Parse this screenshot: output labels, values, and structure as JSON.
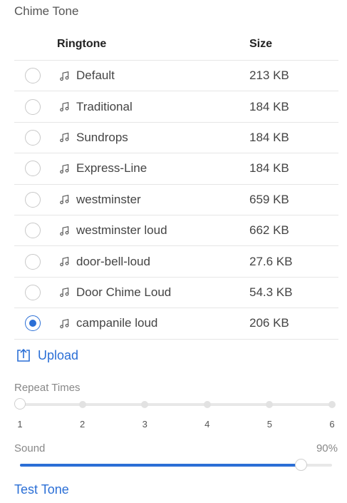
{
  "section_title": "Chime Tone",
  "table": {
    "headers": {
      "ringtone": "Ringtone",
      "size": "Size"
    },
    "rows": [
      {
        "name": "Default",
        "size": "213 KB",
        "selected": false
      },
      {
        "name": "Traditional",
        "size": "184 KB",
        "selected": false
      },
      {
        "name": "Sundrops",
        "size": "184 KB",
        "selected": false
      },
      {
        "name": "Express-Line",
        "size": "184 KB",
        "selected": false
      },
      {
        "name": "westminster",
        "size": "659 KB",
        "selected": false
      },
      {
        "name": "westminster loud",
        "size": "662 KB",
        "selected": false
      },
      {
        "name": "door-bell-loud",
        "size": "27.6 KB",
        "selected": false
      },
      {
        "name": "Door Chime Loud",
        "size": "54.3 KB",
        "selected": false
      },
      {
        "name": "campanile loud",
        "size": "206 KB",
        "selected": true
      }
    ]
  },
  "upload": {
    "label": "Upload",
    "icon": "upload-icon"
  },
  "repeat": {
    "label": "Repeat Times",
    "ticks": [
      "1",
      "2",
      "3",
      "4",
      "5",
      "6"
    ],
    "value": 1
  },
  "sound": {
    "label": "Sound",
    "value_text": "90%",
    "value": 90
  },
  "test_tone": {
    "label": "Test Tone"
  },
  "colors": {
    "accent": "#2b6fd6",
    "divider": "#e6e6e6",
    "muted": "#888888"
  }
}
